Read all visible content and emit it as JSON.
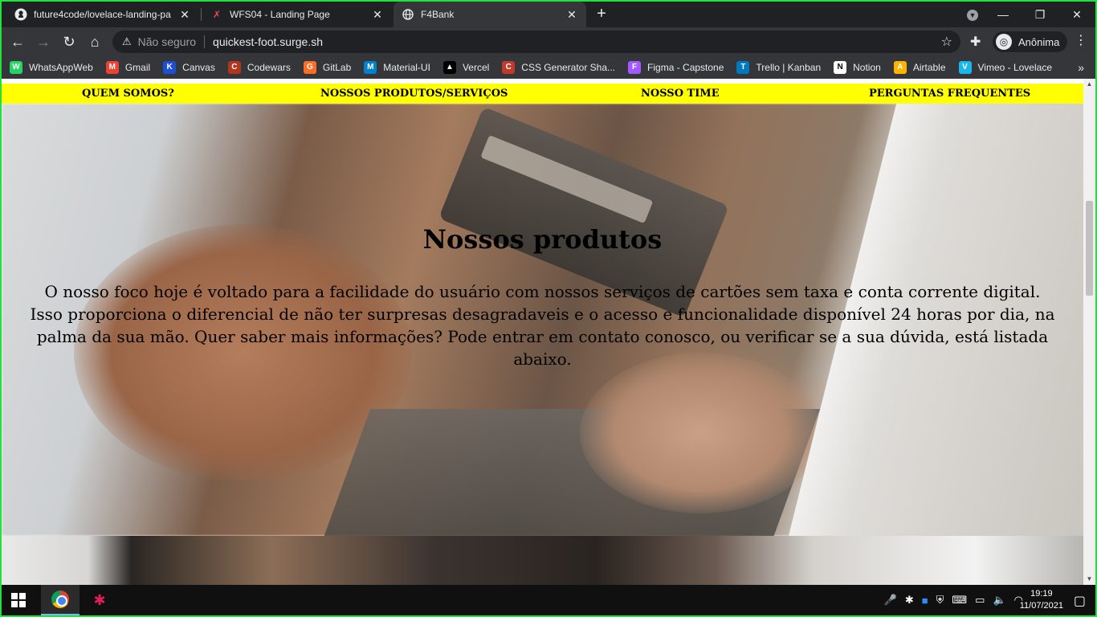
{
  "browser": {
    "tabs": [
      {
        "title": "future4code/lovelace-landing-pa",
        "icon": "github-icon",
        "active": false
      },
      {
        "title": "WFS04 - Landing Page",
        "icon": "wfs-icon",
        "active": false
      },
      {
        "title": "F4Bank",
        "icon": "globe-icon",
        "active": true
      }
    ],
    "security_label": "Não seguro",
    "url": "quickest-foot.surge.sh",
    "profile_label": "Anônima",
    "bookmarks": [
      {
        "label": "WhatsAppWeb",
        "color": "#25d366",
        "glyph": "W"
      },
      {
        "label": "Gmail",
        "color": "#ea4335",
        "glyph": "M"
      },
      {
        "label": "Canvas",
        "color": "#1d4ed8",
        "glyph": "K"
      },
      {
        "label": "Codewars",
        "color": "#b1361e",
        "glyph": "C"
      },
      {
        "label": "GitLab",
        "color": "#fc6d26",
        "glyph": "G"
      },
      {
        "label": "Material-UI",
        "color": "#0081cb",
        "glyph": "M"
      },
      {
        "label": "Vercel",
        "color": "#000000",
        "glyph": "▲"
      },
      {
        "label": "CSS Generator Sha...",
        "color": "#c0392b",
        "glyph": "C"
      },
      {
        "label": "Figma - Capstone",
        "color": "#a259ff",
        "glyph": "F"
      },
      {
        "label": "Trello | Kanban",
        "color": "#0079bf",
        "glyph": "T"
      },
      {
        "label": "Notion",
        "color": "#ffffff",
        "glyph": "N"
      },
      {
        "label": "Airtable",
        "color": "#fcb400",
        "glyph": "A"
      },
      {
        "label": "Vimeo - Lovelace",
        "color": "#1ab7ea",
        "glyph": "V"
      }
    ]
  },
  "site": {
    "nav": [
      {
        "label": "QUEM SOMOS?"
      },
      {
        "label": "NOSSOS PRODUTOS/SERVIÇOS"
      },
      {
        "label": "NOSSO TIME"
      },
      {
        "label": "PERGUNTAS FREQUENTES"
      }
    ],
    "nav_color": "#ffff00",
    "hero": {
      "title": "Nossos produtos",
      "line1": "O nosso foco hoje é voltado para a facilidade do usuário com nossos serviços de cartões sem taxa e conta corrente digital.",
      "line2": "Isso proporciona o diferencial de não ter surpresas desagradaveis e o acesso e funcionalidade disponível 24 horas por dia, na palma da sua mão. Quer saber mais informações? Pode entrar em contato conosco, ou verificar se a sua dúvida, está listada abaixo."
    }
  },
  "taskbar": {
    "time": "19:19",
    "date": "11/07/2021"
  }
}
